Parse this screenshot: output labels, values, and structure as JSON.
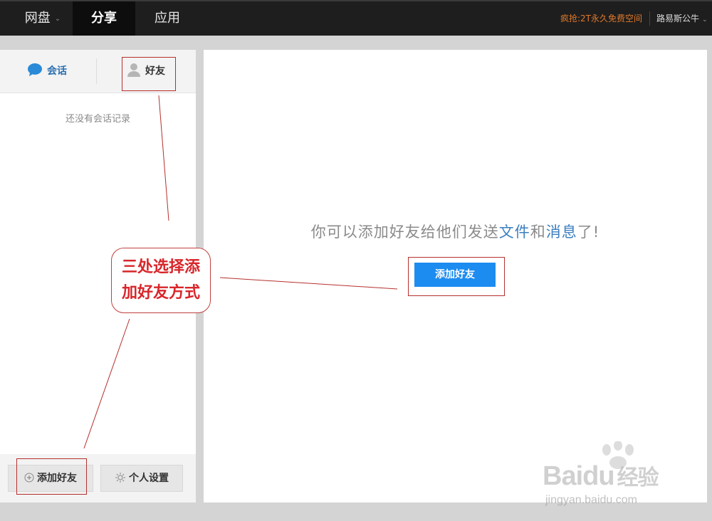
{
  "topbar": {
    "nav": [
      "网盘",
      "分享",
      "应用"
    ],
    "promo": "疯抢:2T永久免费空间",
    "user": "路易斯公牛"
  },
  "sidebar": {
    "tab_chat": "会话",
    "tab_friends": "好友",
    "empty_text": "还没有会话记录",
    "add_friend_button": "添加好友",
    "settings_button": "个人设置"
  },
  "main": {
    "message_prefix": "你可以添加好友给他们发送",
    "message_file": "文件",
    "message_and": "和",
    "message_news": "消息",
    "message_suffix": "了!",
    "add_friend_button": "添加好友"
  },
  "annotation": {
    "line1": "三处选择添",
    "line2": "加好友方式"
  },
  "watermark": {
    "logo": "Baidu",
    "logo_cn": "经验",
    "url": "jingyan.baidu.com"
  },
  "colors": {
    "accent_blue": "#1d8cf0",
    "annotation_red": "#d8262a",
    "promo_orange": "#e0782a"
  }
}
